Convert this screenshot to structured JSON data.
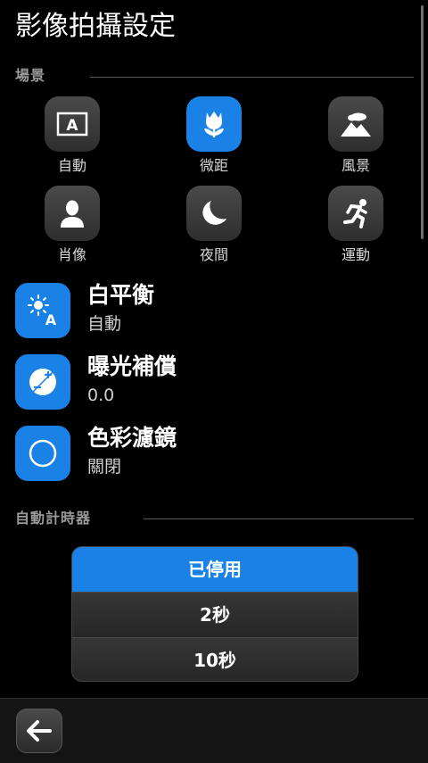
{
  "page_title": "影像拍攝設定",
  "scene_section": {
    "header": "場景"
  },
  "scenes": [
    {
      "label": "自動",
      "icon": "auto-a-icon",
      "selected": false
    },
    {
      "label": "微距",
      "icon": "tulip-icon",
      "selected": true
    },
    {
      "label": "風景",
      "icon": "mountain-icon",
      "selected": false
    },
    {
      "label": "肖像",
      "icon": "person-icon",
      "selected": false
    },
    {
      "label": "夜間",
      "icon": "moon-icon",
      "selected": false
    },
    {
      "label": "運動",
      "icon": "runner-icon",
      "selected": false
    }
  ],
  "settings": [
    {
      "title": "白平衡",
      "value": "自動",
      "icon": "white-balance-icon"
    },
    {
      "title": "曝光補償",
      "value": "0.0",
      "icon": "exposure-icon"
    },
    {
      "title": "色彩濾鏡",
      "value": "關閉",
      "icon": "color-filter-icon"
    }
  ],
  "timer_section": {
    "header": "自動計時器"
  },
  "timer_options": [
    {
      "label": "已停用",
      "selected": true
    },
    {
      "label": "2秒",
      "selected": false
    },
    {
      "label": "10秒",
      "selected": false
    }
  ],
  "bottom_bar": {
    "back_icon": "back-arrow-icon"
  },
  "colors": {
    "accent": "#1a82e6",
    "background": "#000000",
    "tile": "#3c3c3c"
  }
}
